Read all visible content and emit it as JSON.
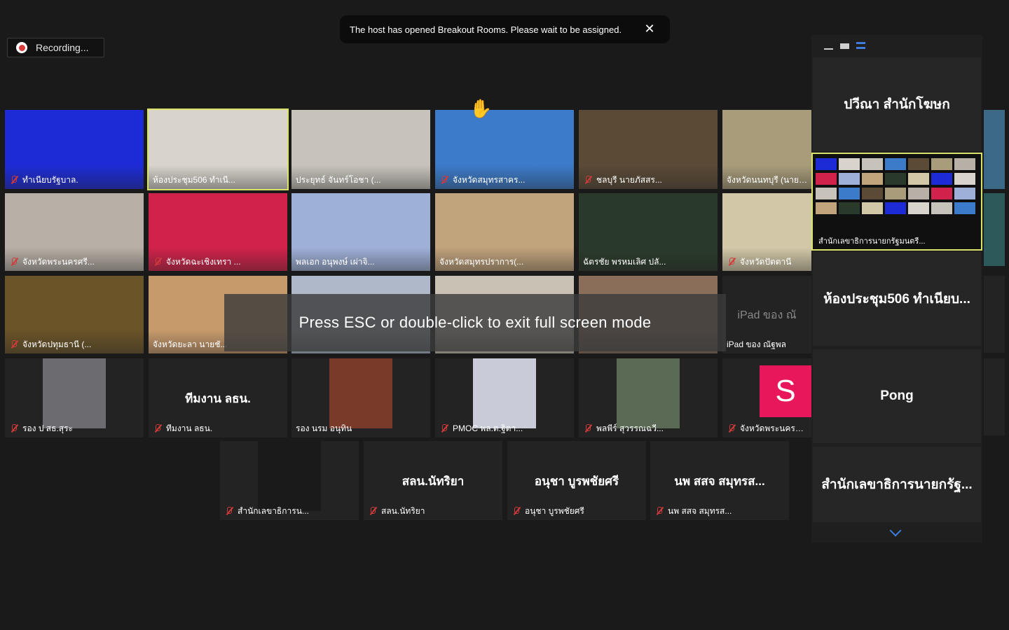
{
  "recording": {
    "label": "Recording..."
  },
  "toast": {
    "message": "The host has opened Breakout Rooms. Please wait to be assigned.",
    "close_glyph": "✕"
  },
  "fullscreen_banner": "Press ESC or double-click to exit full screen mode",
  "grid": {
    "row1": [
      {
        "label": "ทำเนียบรัฐบาล.",
        "bg": "#1d2bd6",
        "muted": true
      },
      {
        "label": "ห้องประชุม506 ทำเนี...",
        "bg": "#d8d4cc",
        "muted": false
      },
      {
        "label": "ประยุทธ์ จันทร์โอชา (...",
        "bg": "#c7c3bb",
        "muted": false
      },
      {
        "label": "จังหวัดสมุทรสาคร...",
        "bg": "#3c7bc9",
        "muted": true
      },
      {
        "label": "ชลบุรี นายภัสสร...",
        "bg": "#5a4a36",
        "muted": true
      },
      {
        "label": "จังหวัดนนทบุรี (นายส...",
        "bg": "#a89c7a",
        "muted": false
      }
    ],
    "row2": [
      {
        "label": "จังหวัดพระนครศรี...",
        "bg": "#b8b0a6",
        "muted": true
      },
      {
        "label": "จังหวัดฉะเชิงเทรา ...",
        "bg": "#d0224a",
        "muted": true
      },
      {
        "label": "พลเอก อนุพงษ์ เผ่าจิ...",
        "bg": "#9fb0d8",
        "muted": false
      },
      {
        "label": "จังหวัดสมุทรปราการ(...",
        "bg": "#c1a37c",
        "muted": false
      },
      {
        "label": "ฉัตรชัย พรหมเลิศ ปลั...",
        "bg": "#2a3a2a",
        "muted": false
      },
      {
        "label": "จังหวัดปัตตานี",
        "bg": "#d2c8a8",
        "muted": true
      }
    ],
    "row3": [
      {
        "label": "จังหวัดปทุมธานี (...",
        "bg": "#6a5428",
        "muted": true
      },
      {
        "label": "จังหวัดยะลา นายชั...",
        "bg": "#c79a6c",
        "muted": false
      },
      {
        "label": "",
        "bg": "#aeb8c8",
        "muted": false
      },
      {
        "label": "",
        "bg": "#c9c2b4",
        "muted": false
      },
      {
        "label": "",
        "bg": "#8a6e5a",
        "muted": false
      },
      {
        "label": "iPad ของ ณัฐพล",
        "bg": "#232323",
        "muted": false,
        "big": "iPad ของ ณั"
      }
    ],
    "row4": [
      {
        "label": "รอง ป สธ.สุระ",
        "bg": "#232323",
        "muted": true,
        "photo": "#6b6b70"
      },
      {
        "label": "ทีมงาน ลธน.",
        "bg": "#232323",
        "muted": true,
        "big": "ทีมงาน ลธน."
      },
      {
        "label": "รอง นรม อนุทิน",
        "bg": "#232323",
        "muted": false,
        "photo": "#7a3a2a"
      },
      {
        "label": "PMOC พล.ต.ฐิตา...",
        "bg": "#232323",
        "muted": true,
        "photo": "#c9cbd8"
      },
      {
        "label": "พลพีร์ สุวรรณฉวี...",
        "bg": "#232323",
        "muted": true,
        "photo": "#5a6a54"
      },
      {
        "label": "จังหวัดพระนครศรี...",
        "bg": "#232323",
        "muted": true,
        "avatar": "S"
      }
    ],
    "row5": [
      {
        "label": "สำนักเลขาธิการน...",
        "bg": "#232323",
        "muted": true,
        "photo": "#1a1a1a"
      },
      {
        "label": "สลน.นัทริยา",
        "bg": "#232323",
        "muted": true,
        "big": "สลน.นัทริยา"
      },
      {
        "label": "อนุชา บูรพชัยศรี",
        "bg": "#232323",
        "muted": true,
        "big": "อนุชา บูรพชัยศรี"
      },
      {
        "label": "นพ สสจ สมุทรส...",
        "bg": "#232323",
        "muted": true,
        "big": "นพ สสจ สมุทรส..."
      }
    ]
  },
  "side_panel": {
    "tiles": [
      {
        "name": "ปวีณา สำนักโฆษก"
      },
      {
        "name": "ห้องประชุม506 ทำเนียบ..."
      },
      {
        "name": "Pong"
      },
      {
        "name": "สำนักเลขาธิการนายกรัฐ..."
      }
    ],
    "share_label": "สำนักเลขาธิการนายกรัฐมนตรี..."
  }
}
